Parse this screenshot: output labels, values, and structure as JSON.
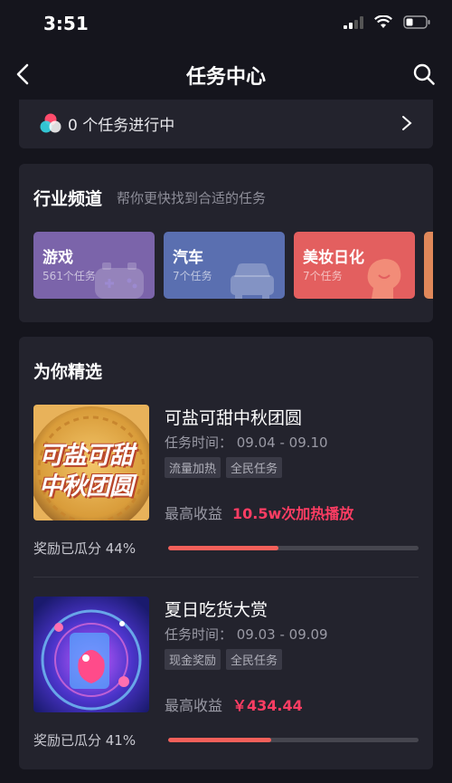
{
  "status_bar": {
    "time": "3:51"
  },
  "nav": {
    "title": "任务中心"
  },
  "in_progress": {
    "text": "0 个任务进行中"
  },
  "industry": {
    "title": "行业频道",
    "subtitle": "帮你更快找到合适的任务",
    "tiles": [
      {
        "name": "游戏",
        "count": "561个任务",
        "color": "#7b64aa",
        "icon": "gamepad-icon"
      },
      {
        "name": "汽车",
        "count": "7个任务",
        "color": "#5a6fb0",
        "icon": "car-icon"
      },
      {
        "name": "美妆日化",
        "count": "7个任务",
        "color": "#e35f5f",
        "icon": "face-icon"
      }
    ]
  },
  "featured": {
    "title": "为你精选",
    "tasks": [
      {
        "name": "可盐可甜中秋团圆",
        "time": "任务时间：  09.04 - 09.10",
        "tags": [
          "流量加热",
          "全民任务"
        ],
        "income_label": "最高收益",
        "income_value": "10.5w次加热播放",
        "reward_text": "奖励已瓜分 44%",
        "reward_fraction": 0.44,
        "thumb_text_1": "可盐可甜",
        "thumb_text_2": "中秋团圆"
      },
      {
        "name": "夏日吃货大赏",
        "time": "任务时间：  09.03 - 09.09",
        "tags": [
          "现金奖励",
          "全民任务"
        ],
        "income_label": "最高收益",
        "income_value": "￥434.44",
        "reward_text": "奖励已瓜分 41%",
        "reward_fraction": 0.41
      }
    ]
  },
  "colors": {
    "accent": "#ff3d63",
    "progress": "#f4605a",
    "card": "#23232d",
    "background": "#15151d"
  }
}
